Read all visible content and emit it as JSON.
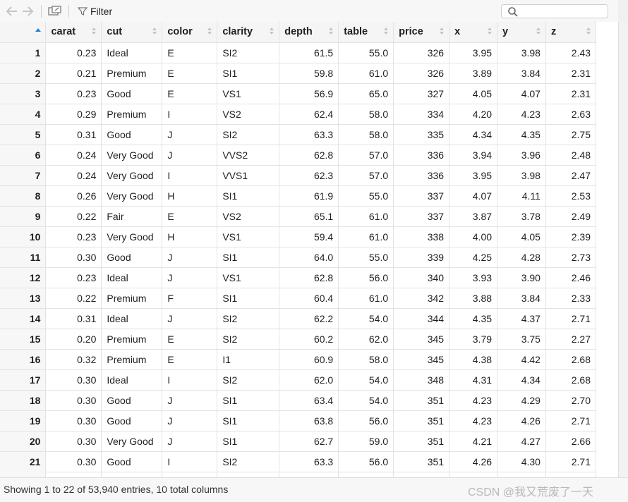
{
  "toolbar": {
    "back_icon": "arrow-left-icon",
    "forward_icon": "arrow-right-icon",
    "popout_icon": "popout-window-icon",
    "filter_label": "Filter",
    "search_placeholder": ""
  },
  "table": {
    "columns": [
      "carat",
      "cut",
      "color",
      "clarity",
      "depth",
      "table",
      "price",
      "x",
      "y",
      "z"
    ],
    "rows": [
      [
        "1",
        "0.23",
        "Ideal",
        "E",
        "SI2",
        "61.5",
        "55.0",
        "326",
        "3.95",
        "3.98",
        "2.43"
      ],
      [
        "2",
        "0.21",
        "Premium",
        "E",
        "SI1",
        "59.8",
        "61.0",
        "326",
        "3.89",
        "3.84",
        "2.31"
      ],
      [
        "3",
        "0.23",
        "Good",
        "E",
        "VS1",
        "56.9",
        "65.0",
        "327",
        "4.05",
        "4.07",
        "2.31"
      ],
      [
        "4",
        "0.29",
        "Premium",
        "I",
        "VS2",
        "62.4",
        "58.0",
        "334",
        "4.20",
        "4.23",
        "2.63"
      ],
      [
        "5",
        "0.31",
        "Good",
        "J",
        "SI2",
        "63.3",
        "58.0",
        "335",
        "4.34",
        "4.35",
        "2.75"
      ],
      [
        "6",
        "0.24",
        "Very Good",
        "J",
        "VVS2",
        "62.8",
        "57.0",
        "336",
        "3.94",
        "3.96",
        "2.48"
      ],
      [
        "7",
        "0.24",
        "Very Good",
        "I",
        "VVS1",
        "62.3",
        "57.0",
        "336",
        "3.95",
        "3.98",
        "2.47"
      ],
      [
        "8",
        "0.26",
        "Very Good",
        "H",
        "SI1",
        "61.9",
        "55.0",
        "337",
        "4.07",
        "4.11",
        "2.53"
      ],
      [
        "9",
        "0.22",
        "Fair",
        "E",
        "VS2",
        "65.1",
        "61.0",
        "337",
        "3.87",
        "3.78",
        "2.49"
      ],
      [
        "10",
        "0.23",
        "Very Good",
        "H",
        "VS1",
        "59.4",
        "61.0",
        "338",
        "4.00",
        "4.05",
        "2.39"
      ],
      [
        "11",
        "0.30",
        "Good",
        "J",
        "SI1",
        "64.0",
        "55.0",
        "339",
        "4.25",
        "4.28",
        "2.73"
      ],
      [
        "12",
        "0.23",
        "Ideal",
        "J",
        "VS1",
        "62.8",
        "56.0",
        "340",
        "3.93",
        "3.90",
        "2.46"
      ],
      [
        "13",
        "0.22",
        "Premium",
        "F",
        "SI1",
        "60.4",
        "61.0",
        "342",
        "3.88",
        "3.84",
        "2.33"
      ],
      [
        "14",
        "0.31",
        "Ideal",
        "J",
        "SI2",
        "62.2",
        "54.0",
        "344",
        "4.35",
        "4.37",
        "2.71"
      ],
      [
        "15",
        "0.20",
        "Premium",
        "E",
        "SI2",
        "60.2",
        "62.0",
        "345",
        "3.79",
        "3.75",
        "2.27"
      ],
      [
        "16",
        "0.32",
        "Premium",
        "E",
        "I1",
        "60.9",
        "58.0",
        "345",
        "4.38",
        "4.42",
        "2.68"
      ],
      [
        "17",
        "0.30",
        "Ideal",
        "I",
        "SI2",
        "62.0",
        "54.0",
        "348",
        "4.31",
        "4.34",
        "2.68"
      ],
      [
        "18",
        "0.30",
        "Good",
        "J",
        "SI1",
        "63.4",
        "54.0",
        "351",
        "4.23",
        "4.29",
        "2.70"
      ],
      [
        "19",
        "0.30",
        "Good",
        "J",
        "SI1",
        "63.8",
        "56.0",
        "351",
        "4.23",
        "4.26",
        "2.71"
      ],
      [
        "20",
        "0.30",
        "Very Good",
        "J",
        "SI1",
        "62.7",
        "59.0",
        "351",
        "4.21",
        "4.27",
        "2.66"
      ],
      [
        "21",
        "0.30",
        "Good",
        "I",
        "SI2",
        "63.3",
        "56.0",
        "351",
        "4.26",
        "4.30",
        "2.71"
      ]
    ]
  },
  "status": {
    "text": "Showing 1 to 22 of 53,940 entries, 10 total columns",
    "watermark": "CSDN @我又荒废了一天"
  },
  "colors": {
    "sort_active": "#2a7fd4",
    "header_bg": "#f5f5f5",
    "grid_line": "#e3e3e3"
  }
}
